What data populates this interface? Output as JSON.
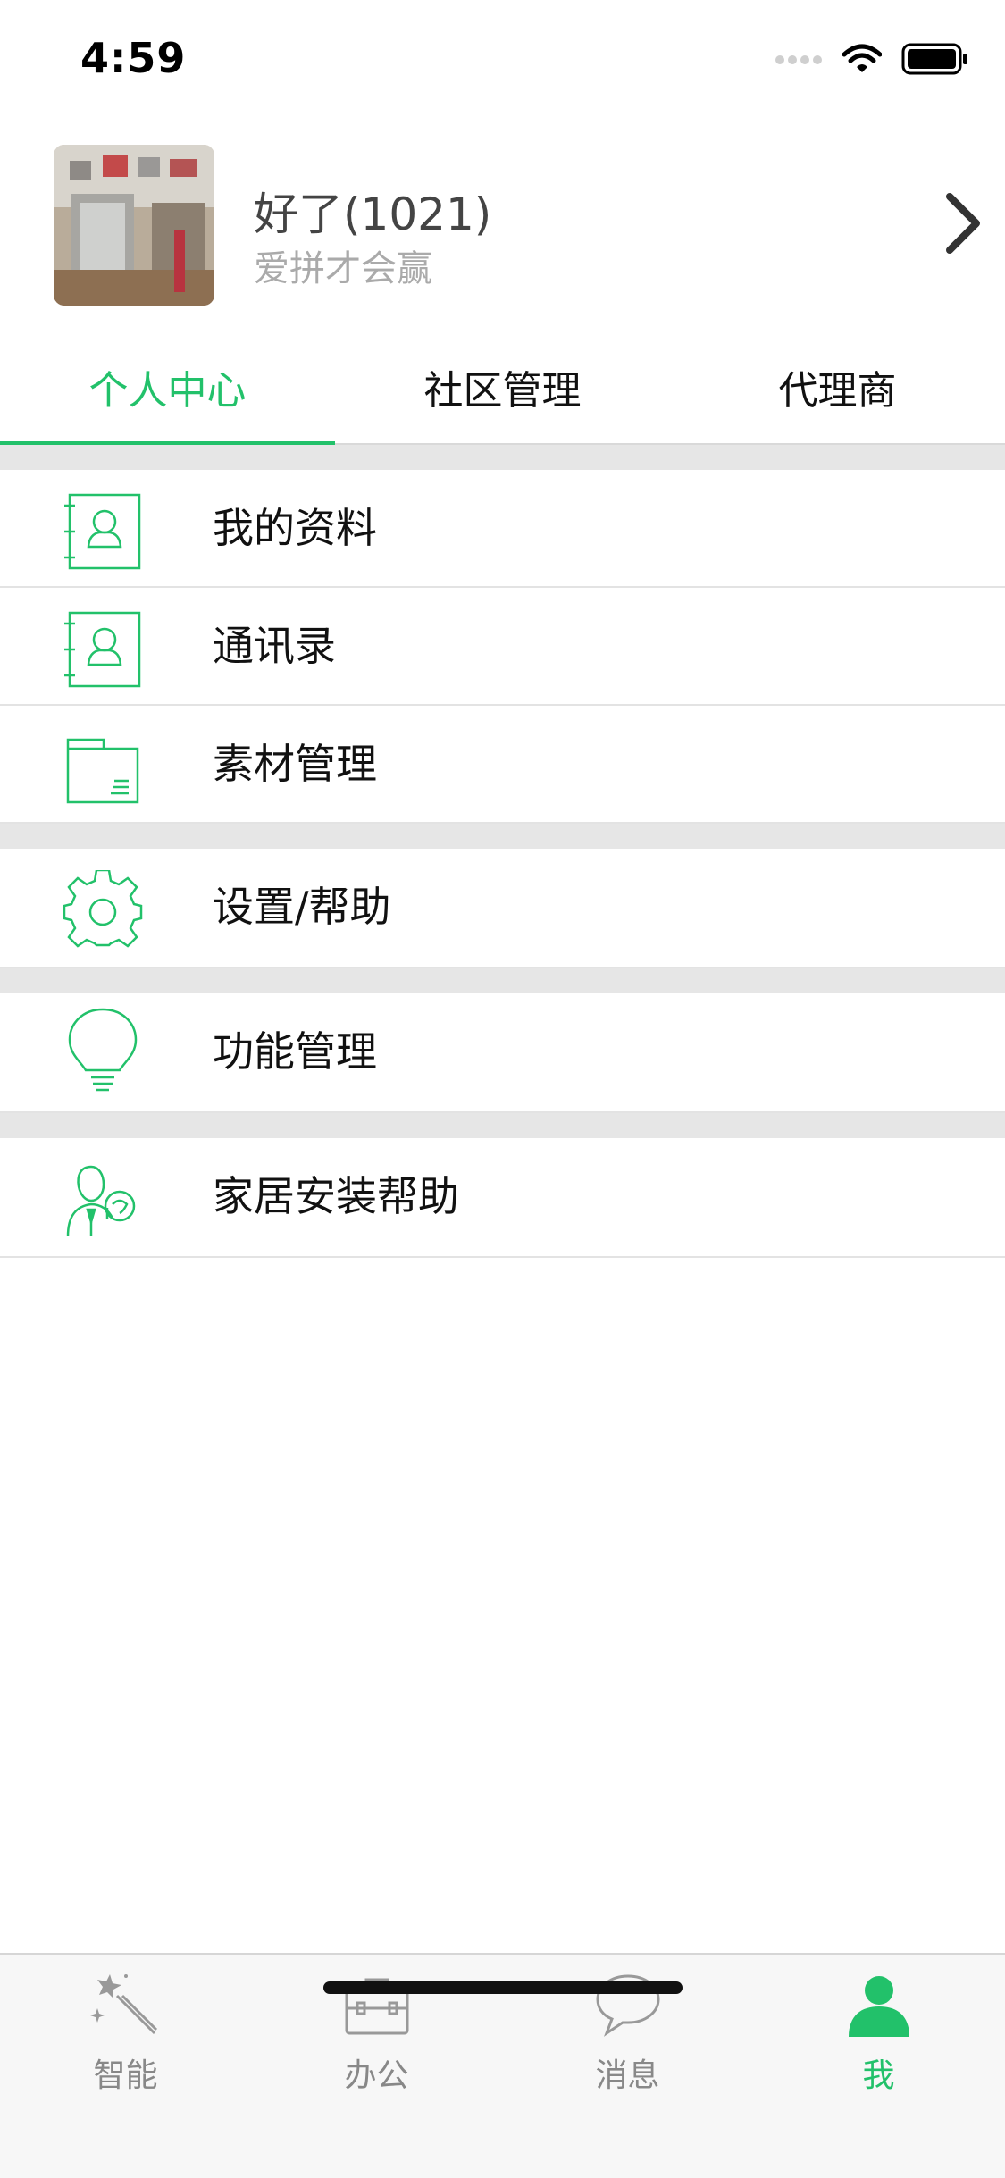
{
  "status_bar": {
    "time": "4:59"
  },
  "profile": {
    "name": "好了(1021)",
    "subtitle": "爱拼才会赢"
  },
  "tabs": [
    {
      "label": "个人中心",
      "active": true
    },
    {
      "label": "社区管理",
      "active": false
    },
    {
      "label": "代理商",
      "active": false
    }
  ],
  "menu": [
    {
      "label": "我的资料",
      "icon": "contact-card-icon"
    },
    {
      "label": "通讯录",
      "icon": "contact-card-icon"
    },
    {
      "label": "素材管理",
      "icon": "folder-icon"
    },
    {
      "label": "设置/帮助",
      "icon": "gear-icon"
    },
    {
      "label": "功能管理",
      "icon": "lightbulb-icon"
    },
    {
      "label": "家居安装帮助",
      "icon": "support-agent-icon"
    }
  ],
  "tabbar": [
    {
      "label": "智能",
      "icon": "magic-wand-icon",
      "active": false
    },
    {
      "label": "办公",
      "icon": "briefcase-icon",
      "active": false
    },
    {
      "label": "消息",
      "icon": "chat-bubble-icon",
      "active": false
    },
    {
      "label": "我",
      "icon": "person-icon",
      "active": true
    }
  ],
  "colors": {
    "accent": "#22c16a",
    "divider": "#e6e6e6",
    "tabbar_bg": "#f7f7f7"
  }
}
